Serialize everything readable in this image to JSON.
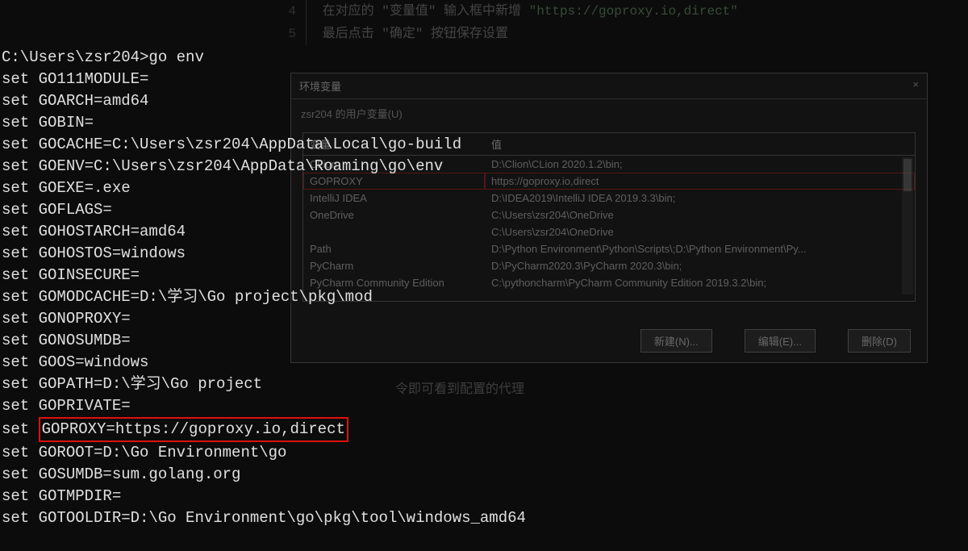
{
  "terminal": {
    "prompt": "C:\\Users\\zsr204>go env",
    "lines": [
      "set GO111MODULE=",
      "set GOARCH=amd64",
      "set GOBIN=",
      "set GOCACHE=C:\\Users\\zsr204\\AppData\\Local\\go-build",
      "set GOENV=C:\\Users\\zsr204\\AppData\\Roaming\\go\\env",
      "set GOEXE=.exe",
      "set GOFLAGS=",
      "set GOHOSTARCH=amd64",
      "set GOHOSTOS=windows",
      "set GOINSECURE=",
      "set GOMODCACHE=D:\\学习\\Go project\\pkg\\mod",
      "set GONOPROXY=",
      "set GONOSUMDB=",
      "set GOOS=windows",
      "set GOPATH=D:\\学习\\Go project",
      "set GOPRIVATE="
    ],
    "highlighted_prefix": "set ",
    "highlighted_line": "GOPROXY=https://goproxy.io,direct",
    "lines_after": [
      "set GOROOT=D:\\Go Environment\\go",
      "set GOSUMDB=sum.golang.org",
      "set GOTMPDIR=",
      "set GOTOOLDIR=D:\\Go Environment\\go\\pkg\\tool\\windows_amd64"
    ]
  },
  "instructions": {
    "step4_num": "4",
    "step4_text": "在对应的 \"变量值\" 输入框中新增 ",
    "step4_url": "\"https://goproxy.io,direct\"",
    "step5_num": "5",
    "step5_text": "最后点击 \"确定\" 按钮保存设置"
  },
  "dialog": {
    "title": "环境变量",
    "subtitle": "zsr204 的用户变量(U)",
    "header_var": "变量",
    "header_val": "值",
    "rows": [
      {
        "name": "CLion",
        "value": "D:\\Clion\\CLion 2020.1.2\\bin;"
      },
      {
        "name": "GOPROXY",
        "value": "https://goproxy.io,direct"
      },
      {
        "name": "IntelliJ IDEA",
        "value": "D:\\IDEA2019\\IntelliJ IDEA 2019.3.3\\bin;"
      },
      {
        "name": "OneDrive",
        "value": "C:\\Users\\zsr204\\OneDrive"
      },
      {
        "name": "",
        "value": "C:\\Users\\zsr204\\OneDrive"
      },
      {
        "name": "Path",
        "value": "D:\\Python Environment\\Python\\Scripts\\;D:\\Python Environment\\Py..."
      },
      {
        "name": "PyCharm",
        "value": "D:\\PyCharm2020.3\\PyCharm 2020.3\\bin;"
      },
      {
        "name": "PyCharm Community Edition",
        "value": "C:\\pythoncharm\\PyCharm Community Edition 2019.3.2\\bin;"
      }
    ],
    "btn_new": "新建(N)...",
    "btn_edit": "编辑(E)...",
    "btn_delete": "删除(D)"
  },
  "bg_note": "令即可看到配置的代理"
}
